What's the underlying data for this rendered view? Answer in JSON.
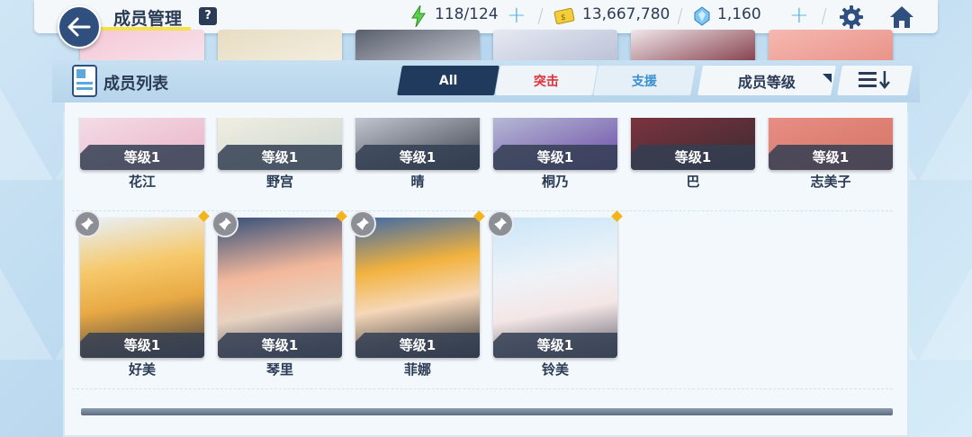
{
  "header": {
    "title": "成员管理",
    "help_label": "?",
    "ap": "118/124",
    "credits": "13,667,780",
    "gems": "1,160",
    "plus": "+"
  },
  "panel": {
    "title": "成员列表",
    "tabs": [
      "All",
      "突击",
      "支援"
    ],
    "sort_label": "成员等级"
  },
  "students_row1": [
    {
      "name": "花江",
      "level": "等级1"
    },
    {
      "name": "野宫",
      "level": "等级1"
    },
    {
      "name": "晴",
      "level": "等级1"
    },
    {
      "name": "桐乃",
      "level": "等级1"
    },
    {
      "name": "巴",
      "level": "等级1"
    },
    {
      "name": "志美子",
      "level": "等级1"
    }
  ],
  "students_row2": [
    {
      "name": "好美",
      "level": "等级1"
    },
    {
      "name": "琴里",
      "level": "等级1"
    },
    {
      "name": "菲娜",
      "level": "等级1"
    },
    {
      "name": "铃美",
      "level": "等级1"
    }
  ],
  "colors": {
    "accent": "#2f4f7e",
    "tab_active": "#1f3a5c",
    "strike_red": "#e0303a",
    "support_blue": "#3a8fd0",
    "new_dot": "#f4b51c"
  },
  "icons": [
    "back-arrow-icon",
    "help-icon",
    "ap-bolt-icon",
    "credit-icon",
    "gem-icon",
    "gear-icon",
    "home-icon",
    "student-card-icon",
    "sort-order-icon",
    "pin-icon"
  ]
}
